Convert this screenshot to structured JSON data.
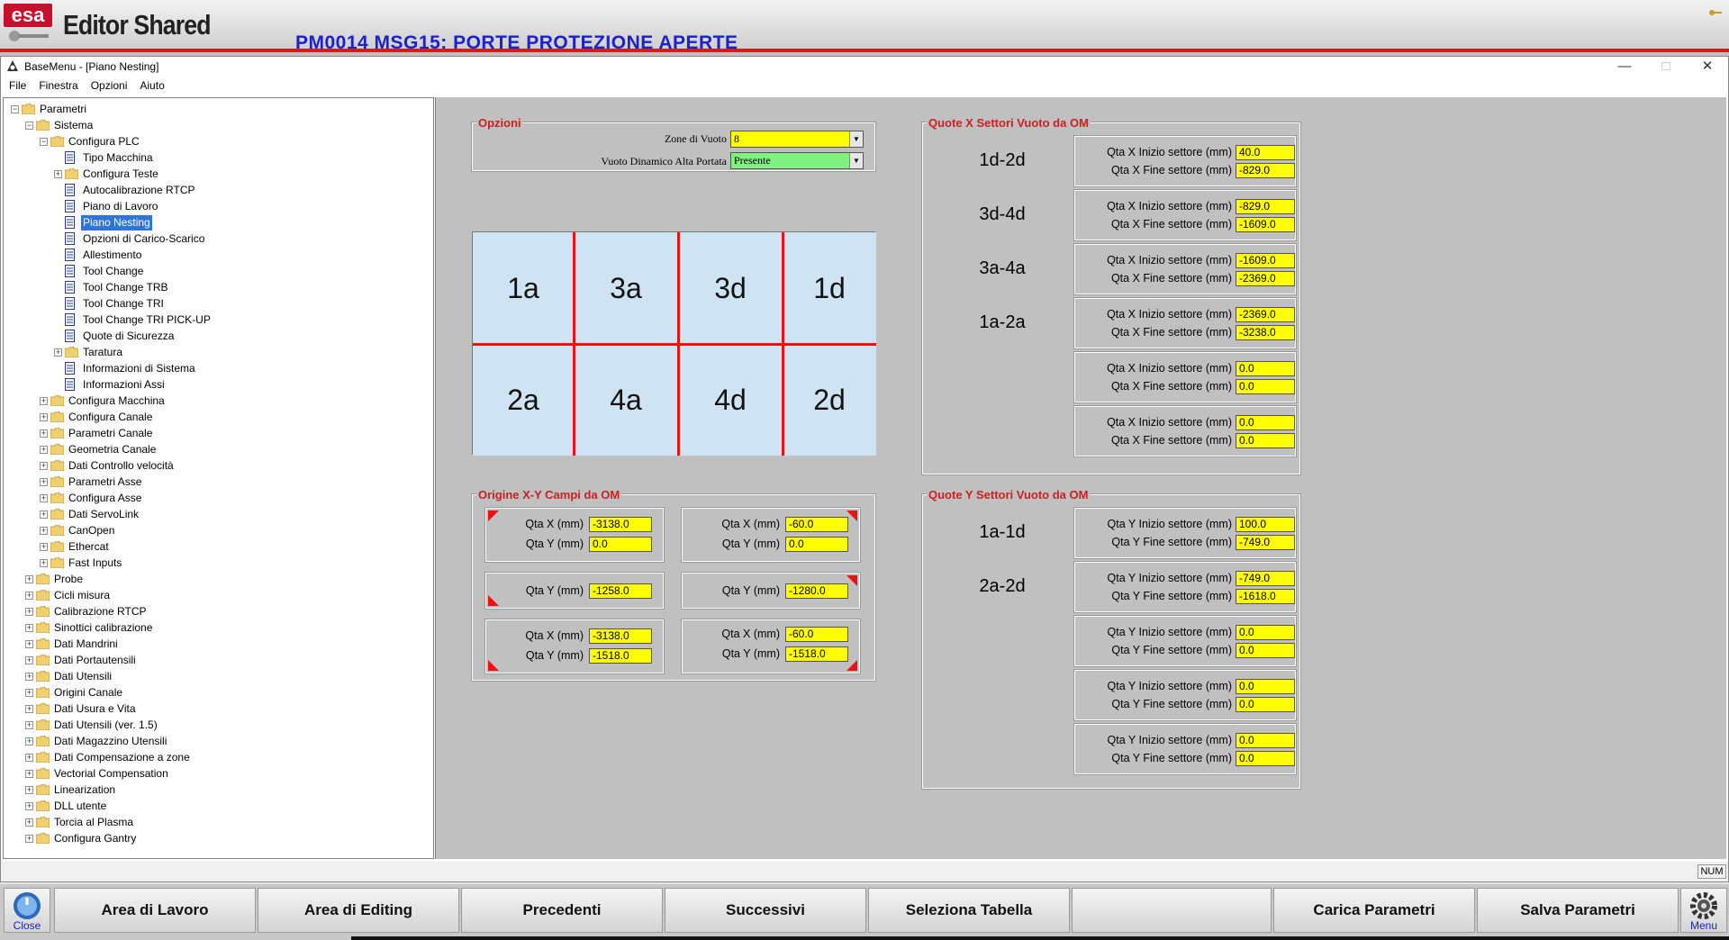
{
  "app": {
    "title": "Editor Shared",
    "alarm": "PM0014 MSG15: PORTE PROTEZIONE APERTE"
  },
  "window": {
    "title": "BaseMenu - [Piano Nesting]",
    "min": "—",
    "max": "□",
    "close": "✕"
  },
  "menu": [
    "File",
    "Finestra",
    "Opzioni",
    "Aiuto"
  ],
  "tree": [
    {
      "label": "Parametri",
      "lvl": 0,
      "exp": "-",
      "icon": "folder"
    },
    {
      "label": "Sistema",
      "lvl": 1,
      "exp": "-",
      "icon": "folder"
    },
    {
      "label": "Configura PLC",
      "lvl": 2,
      "exp": "-",
      "icon": "folder"
    },
    {
      "label": "Tipo Macchina",
      "lvl": 3,
      "exp": "",
      "icon": "doc"
    },
    {
      "label": "Configura Teste",
      "lvl": 3,
      "exp": "+",
      "icon": "folder"
    },
    {
      "label": "Autocalibrazione RTCP",
      "lvl": 3,
      "exp": "",
      "icon": "doc"
    },
    {
      "label": "Piano di Lavoro",
      "lvl": 3,
      "exp": "",
      "icon": "doc"
    },
    {
      "label": "Piano Nesting",
      "lvl": 3,
      "exp": "",
      "icon": "doc",
      "sel": true
    },
    {
      "label": "Opzioni di Carico-Scarico",
      "lvl": 3,
      "exp": "",
      "icon": "doc"
    },
    {
      "label": "Allestimento",
      "lvl": 3,
      "exp": "",
      "icon": "doc"
    },
    {
      "label": "Tool Change",
      "lvl": 3,
      "exp": "",
      "icon": "doc"
    },
    {
      "label": "Tool Change TRB",
      "lvl": 3,
      "exp": "",
      "icon": "doc"
    },
    {
      "label": "Tool Change TRI",
      "lvl": 3,
      "exp": "",
      "icon": "doc"
    },
    {
      "label": "Tool Change TRI PICK-UP",
      "lvl": 3,
      "exp": "",
      "icon": "doc"
    },
    {
      "label": "Quote di Sicurezza",
      "lvl": 3,
      "exp": "",
      "icon": "doc"
    },
    {
      "label": "Taratura",
      "lvl": 3,
      "exp": "+",
      "icon": "folder"
    },
    {
      "label": "Informazioni di Sistema",
      "lvl": 3,
      "exp": "",
      "icon": "doc"
    },
    {
      "label": "Informazioni Assi",
      "lvl": 3,
      "exp": "",
      "icon": "doc"
    },
    {
      "label": "Configura Macchina",
      "lvl": 2,
      "exp": "+",
      "icon": "folder"
    },
    {
      "label": "Configura Canale",
      "lvl": 2,
      "exp": "+",
      "icon": "folder"
    },
    {
      "label": "Parametri Canale",
      "lvl": 2,
      "exp": "+",
      "icon": "folder"
    },
    {
      "label": "Geometria Canale",
      "lvl": 2,
      "exp": "+",
      "icon": "folder"
    },
    {
      "label": "Dati Controllo velocità",
      "lvl": 2,
      "exp": "+",
      "icon": "folder"
    },
    {
      "label": "Parametri Asse",
      "lvl": 2,
      "exp": "+",
      "icon": "folder"
    },
    {
      "label": "Configura Asse",
      "lvl": 2,
      "exp": "+",
      "icon": "folder"
    },
    {
      "label": "Dati ServoLink",
      "lvl": 2,
      "exp": "+",
      "icon": "folder"
    },
    {
      "label": "CanOpen",
      "lvl": 2,
      "exp": "+",
      "icon": "folder"
    },
    {
      "label": "Ethercat",
      "lvl": 2,
      "exp": "+",
      "icon": "folder"
    },
    {
      "label": "Fast Inputs",
      "lvl": 2,
      "exp": "+",
      "icon": "folder"
    },
    {
      "label": "Probe",
      "lvl": 1,
      "exp": "+",
      "icon": "folder"
    },
    {
      "label": "Cicli misura",
      "lvl": 1,
      "exp": "+",
      "icon": "folder"
    },
    {
      "label": "Calibrazione RTCP",
      "lvl": 1,
      "exp": "+",
      "icon": "folder"
    },
    {
      "label": "Sinottici calibrazione",
      "lvl": 1,
      "exp": "+",
      "icon": "folder"
    },
    {
      "label": "Dati Mandrini",
      "lvl": 1,
      "exp": "+",
      "icon": "folder"
    },
    {
      "label": "Dati Portautensili",
      "lvl": 1,
      "exp": "+",
      "icon": "folder"
    },
    {
      "label": "Dati Utensili",
      "lvl": 1,
      "exp": "+",
      "icon": "folder"
    },
    {
      "label": "Origini Canale",
      "lvl": 1,
      "exp": "+",
      "icon": "folder"
    },
    {
      "label": "Dati Usura e Vita",
      "lvl": 1,
      "exp": "+",
      "icon": "folder"
    },
    {
      "label": "Dati Utensili (ver. 1.5)",
      "lvl": 1,
      "exp": "+",
      "icon": "folder"
    },
    {
      "label": "Dati Magazzino Utensili",
      "lvl": 1,
      "exp": "+",
      "icon": "folder"
    },
    {
      "label": "Dati Compensazione a zone",
      "lvl": 1,
      "exp": "+",
      "icon": "folder"
    },
    {
      "label": "Vectorial Compensation",
      "lvl": 1,
      "exp": "+",
      "icon": "folder"
    },
    {
      "label": "Linearization",
      "lvl": 1,
      "exp": "+",
      "icon": "folder"
    },
    {
      "label": "DLL utente",
      "lvl": 1,
      "exp": "+",
      "icon": "folder"
    },
    {
      "label": "Torcia al Plasma",
      "lvl": 1,
      "exp": "+",
      "icon": "folder"
    },
    {
      "label": "Configura Gantry",
      "lvl": 1,
      "exp": "+",
      "icon": "folder"
    }
  ],
  "opzioni": {
    "title": "Opzioni",
    "zone_label": "Zone di Vuoto",
    "zone_value": "8",
    "vuoto_label": "Vuoto Dinamico Alta Portata",
    "vuoto_value": "Presente"
  },
  "zones": [
    "1a",
    "3a",
    "3d",
    "1d",
    "2a",
    "4a",
    "4d",
    "2d"
  ],
  "origine": {
    "title": "Origine X-Y Campi da OM",
    "cells": [
      {
        "rows": [
          {
            "l": "Qta X (mm)",
            "v": "-3138.0"
          },
          {
            "l": "Qta Y (mm)",
            "v": "0.0"
          }
        ]
      },
      {
        "rows": [
          {
            "l": "Qta X (mm)",
            "v": "-60.0"
          },
          {
            "l": "Qta Y (mm)",
            "v": "0.0"
          }
        ]
      },
      {
        "rows": [
          {
            "l": "Qta Y (mm)",
            "v": "-1258.0"
          }
        ]
      },
      {
        "rows": [
          {
            "l": "Qta Y (mm)",
            "v": "-1280.0"
          }
        ]
      },
      {
        "rows": [
          {
            "l": "Qta X (mm)",
            "v": "-3138.0"
          },
          {
            "l": "Qta Y (mm)",
            "v": "-1518.0"
          }
        ]
      },
      {
        "rows": [
          {
            "l": "Qta X (mm)",
            "v": "-60.0"
          },
          {
            "l": "Qta Y (mm)",
            "v": "-1518.0"
          }
        ]
      }
    ]
  },
  "quoteX": {
    "title": "Quote X Settori Vuoto da OM",
    "l1": "Qta X Inizio settore (mm)",
    "l2": "Qta X Fine settore (mm)",
    "rows": [
      {
        "name": "1d-2d",
        "a": "40.0",
        "b": "-829.0"
      },
      {
        "name": "3d-4d",
        "a": "-829.0",
        "b": "-1609.0"
      },
      {
        "name": "3a-4a",
        "a": "-1609.0",
        "b": "-2369.0"
      },
      {
        "name": "1a-2a",
        "a": "-2369.0",
        "b": "-3238.0"
      },
      {
        "name": "",
        "a": "0.0",
        "b": "0.0"
      },
      {
        "name": "",
        "a": "0.0",
        "b": "0.0"
      }
    ]
  },
  "quoteY": {
    "title": "Quote Y Settori Vuoto da OM",
    "l1": "Qta Y Inizio settore (mm)",
    "l2": "Qta Y Fine settore (mm)",
    "rows": [
      {
        "name": "1a-1d",
        "a": "100.0",
        "b": "-749.0"
      },
      {
        "name": "2a-2d",
        "a": "-749.0",
        "b": "-1618.0"
      },
      {
        "name": "",
        "a": "0.0",
        "b": "0.0"
      },
      {
        "name": "",
        "a": "0.0",
        "b": "0.0"
      },
      {
        "name": "",
        "a": "0.0",
        "b": "0.0"
      }
    ]
  },
  "status": {
    "num": "NUM"
  },
  "buttons": {
    "close": "Close",
    "b1": "Area di Lavoro",
    "b2": "Area di Editing",
    "b3": "Precedenti",
    "b4": "Successivi",
    "b5": "Seleziona Tabella",
    "b6": "",
    "b7": "Carica  Parametri",
    "b8": "Salva  Parametri",
    "menu": "Menu"
  },
  "colors": {
    "accent_red": "#d01c1c",
    "alarm_blue": "#1a22c8",
    "field_yellow": "#ffff00",
    "combo_green": "#80f080"
  }
}
